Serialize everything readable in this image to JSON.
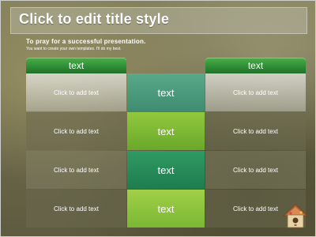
{
  "slide": {
    "title": "Click to edit title style",
    "subtitle": "To pray  for  a successful presentation.",
    "subtext": "You want to create your own templates. I'll do my best."
  },
  "table": {
    "left_header": "text",
    "right_header": "text",
    "rows": [
      {
        "left": "Click to add text",
        "middle": "text",
        "right": "Click to add text"
      },
      {
        "left": "Click to add text",
        "middle": "text",
        "right": "Click to add text"
      },
      {
        "left": "Click to add text",
        "middle": "text",
        "right": "Click to add text"
      },
      {
        "left": "Click to add text",
        "middle": "text",
        "right": "Click to add text"
      }
    ]
  },
  "colors": {
    "header_green": "#2f8f36",
    "mid_row_1": "#4a9a7d",
    "mid_row_2": "#7cb832",
    "mid_row_3": "#2b8f5a",
    "mid_row_4": "#8cc037"
  },
  "icons": {
    "corner": "birdhouse-icon"
  }
}
